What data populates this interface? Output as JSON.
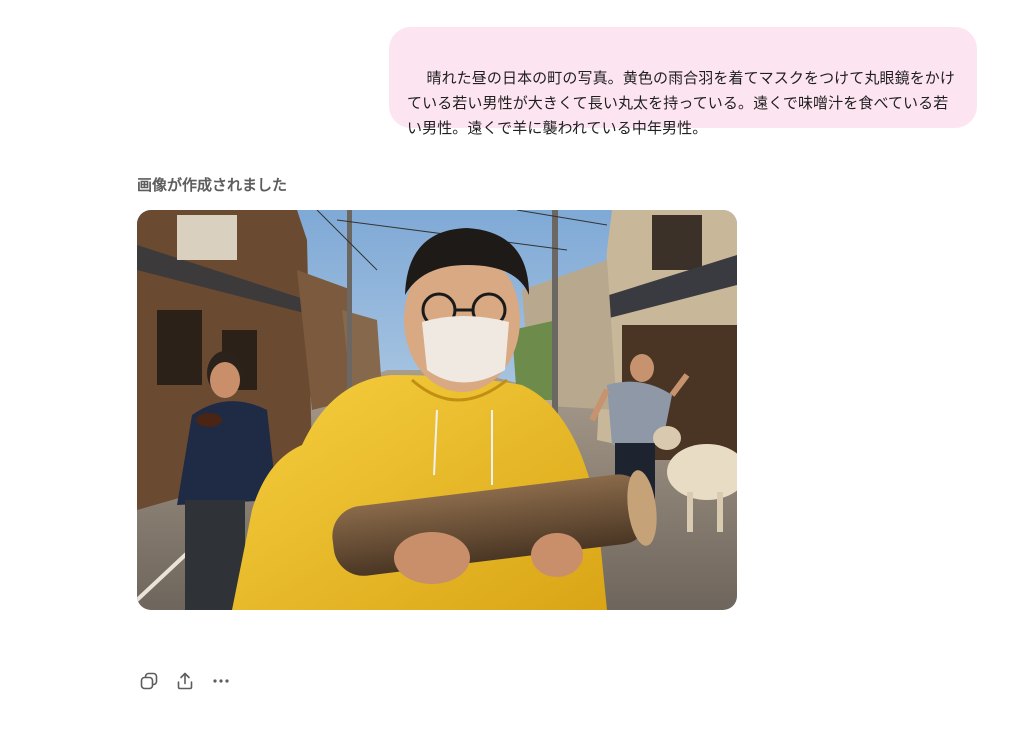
{
  "user_message": {
    "text": "晴れた昼の日本の町の写真。黄色の雨合羽を着てマスクをつけて丸眼鏡をかけている若い男性が大きくて長い丸太を持っている。遠くで味噌汁を食べている若い男性。遠くで羊に襲われている中年男性。",
    "bubble_color": "#fde4f1"
  },
  "assistant": {
    "status_text": "画像が作成されました",
    "image": {
      "description_icon": "generated-photo"
    },
    "actions": [
      {
        "name": "copy-button",
        "icon": "copy-icon"
      },
      {
        "name": "share-button",
        "icon": "share-icon"
      },
      {
        "name": "more-options-button",
        "icon": "more-horizontal-icon"
      }
    ]
  },
  "colors": {
    "raincoat": "#f2c12e",
    "sky": "#a9c8e6",
    "text_muted": "#5d5d5d"
  }
}
